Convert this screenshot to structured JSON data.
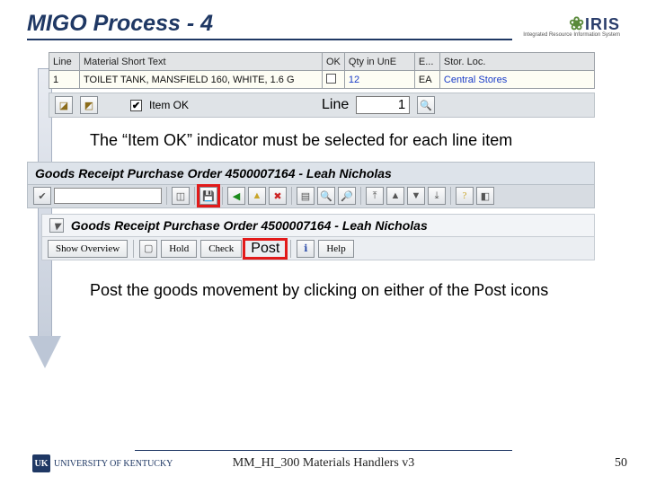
{
  "title": "MIGO Process - 4",
  "iris": {
    "name": "IRIS",
    "sub": "Integrated Resource Information System"
  },
  "grid": {
    "headers": [
      "Line",
      "Material Short Text",
      "OK",
      "Qty in UnE",
      "E...",
      "Stor. Loc."
    ],
    "row": {
      "line": "1",
      "material": "TOILET TANK, MANSFIELD 160, WHITE, 1.6 G",
      "qty": "12",
      "e": "EA",
      "stor": "Central Stores"
    }
  },
  "itemok": {
    "label": "Item OK",
    "line_label": "Line",
    "line_value": "1"
  },
  "note1": "The “Item OK” indicator must be selected for each line item",
  "titlebar": "Goods Receipt Purchase Order 4500007164 - Leah Nicholas",
  "toolbar1": {
    "icons": [
      "check-icon",
      "blank",
      "doc-icon",
      "save-icon",
      "back-icon",
      "forward-icon",
      "cancel-icon",
      "page-icon",
      "find-icon",
      "copy-icon",
      "layout-icon",
      "layout2-icon",
      "overview-icon",
      "help-icon",
      "info-icon"
    ]
  },
  "titlebar2": "Goods Receipt Purchase Order 4500007164 - Leah Nicholas",
  "toolbar2": {
    "show_overview": "Show Overview",
    "hold": "Hold",
    "check": "Check",
    "post": "Post",
    "help": "Help"
  },
  "note2": "Post the goods movement by clicking on either of the Post icons",
  "footer": {
    "uk": "UNIVERSITY OF KENTUCKY",
    "badge": "UK",
    "center": "MM_HI_300 Materials Handlers v3",
    "page": "50"
  }
}
